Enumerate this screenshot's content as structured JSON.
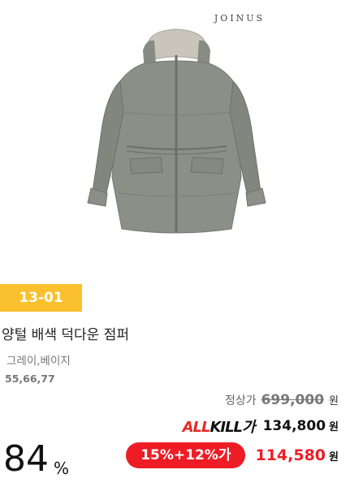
{
  "brand": "JOINUS",
  "badge": "13-01",
  "product": {
    "title": "양털 배색 덕다운 점퍼",
    "colors": "그레이,베이지",
    "sizes": "55,66,77"
  },
  "pricing": {
    "regular_label": "정상가",
    "regular_price": "699,000",
    "allkill_logo_a": "ALL",
    "allkill_logo_rest": "KILL가",
    "allkill_price": "134,800",
    "coupon": "15%+12%가",
    "final_price": "114,580",
    "won": "원",
    "discount_number": "84",
    "discount_unit": "%"
  },
  "colors_hex": {
    "badge": "#fbc02d",
    "coupon": "#ee1c25",
    "jacket": "#8a8f88",
    "collar": "#c9c5bb"
  },
  "icons": {
    "product": "puffer-jacket-image"
  }
}
